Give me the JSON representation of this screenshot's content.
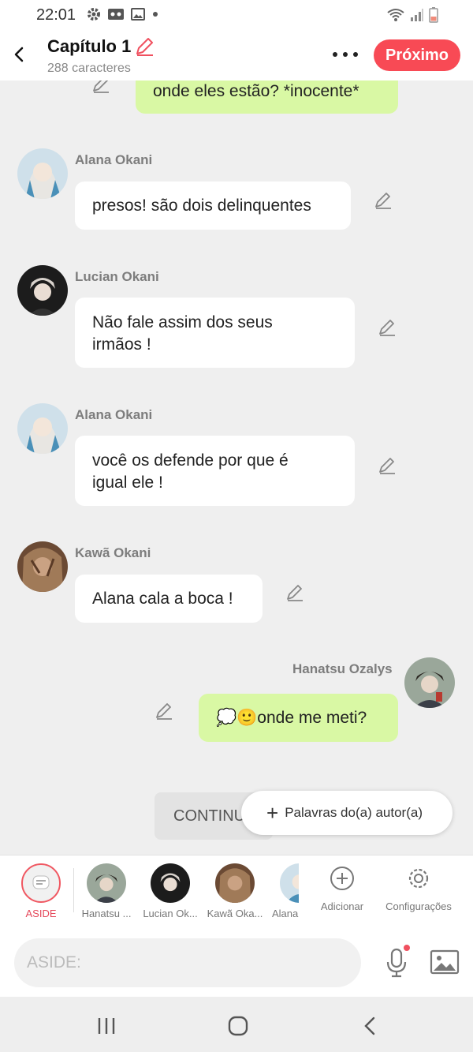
{
  "status": {
    "time": "22:01"
  },
  "header": {
    "title": "Capítulo 1",
    "subtitle": "288 caracteres",
    "next_label": "Próximo"
  },
  "messages": [
    {
      "author": "",
      "text": "onde eles estão? *inocente*",
      "side": "right"
    },
    {
      "author": "Alana Okani",
      "text": "presos! são dois delinquentes",
      "side": "left"
    },
    {
      "author": "Lucian Okani",
      "text_lines": [
        "Não fale assim dos seus",
        "irmãos !"
      ],
      "side": "left"
    },
    {
      "author": "Alana Okani",
      "text_lines": [
        "você os defende por que é",
        "igual ele !"
      ],
      "side": "left"
    },
    {
      "author": "Kawã Okani",
      "text": "Alana cala a boca !",
      "side": "left"
    },
    {
      "author": "Hanatsu Ozalys",
      "text": "💭🙂onde me meti?",
      "side": "right"
    }
  ],
  "continue_label": "CONTINU",
  "author_words_label": "Palavras do(a) autor(a)",
  "charbar": {
    "aside_label": "ASIDE",
    "characters": [
      "Hanatsu ...",
      "Lucian Ok...",
      "Kawã Oka...",
      "Alana"
    ],
    "add_label": "Adicionar",
    "settings_label": "Configurações"
  },
  "input": {
    "placeholder": "ASIDE:"
  },
  "colors": {
    "accent": "#f84a55",
    "my_bubble": "#d9f8a4",
    "background": "#efefef"
  }
}
